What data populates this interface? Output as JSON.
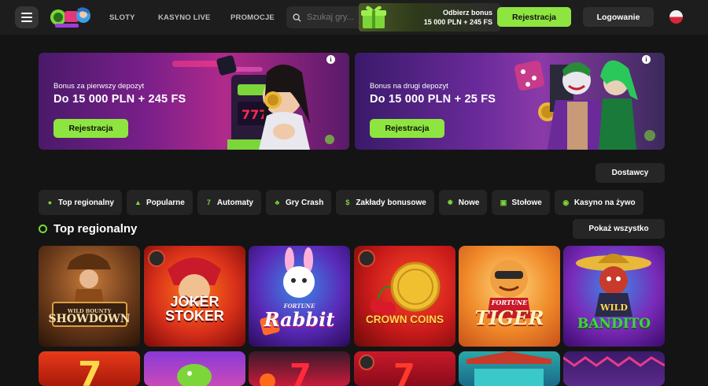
{
  "header": {
    "nav": [
      "SLOTY",
      "KASYNO LIVE",
      "PROMOCJE"
    ],
    "search_placeholder": "Szukaj gry...",
    "bonus_line1": "Odbierz bonus",
    "bonus_line2": "15 000 PLN + 245 FS",
    "register_label": "Rejestracja",
    "login_label": "Logowanie",
    "language": "PL"
  },
  "banners": [
    {
      "subtitle": "Bonus za pierwszy depozyt",
      "headline": "Do 15 000 PLN + 245 FS",
      "cta": "Rejestracja",
      "info": "i"
    },
    {
      "subtitle": "Bonus na drugi depozyt",
      "headline": "Do 15 000 PLN + 25 FS",
      "cta": "Rejestracja",
      "info": "i"
    }
  ],
  "providers_label": "Dostawcy",
  "categories": [
    {
      "label": "Top regionalny",
      "icon": "globe-icon"
    },
    {
      "label": "Popularne",
      "icon": "flame-icon"
    },
    {
      "label": "Automaty",
      "icon": "seven-icon"
    },
    {
      "label": "Gry Crash",
      "icon": "crash-icon"
    },
    {
      "label": "Zakłady bonusowe",
      "icon": "coin-icon"
    },
    {
      "label": "Nowe",
      "icon": "star-icon"
    },
    {
      "label": "Stołowe",
      "icon": "cards-icon"
    },
    {
      "label": "Kasyno na żywo",
      "icon": "live-icon"
    }
  ],
  "section": {
    "title": "Top regionalny",
    "show_all": "Pokaż wszystko"
  },
  "games": [
    {
      "name": "SHOWDOWN",
      "top": "WILD BOUNTY"
    },
    {
      "name": "JOKER STOKER",
      "top": ""
    },
    {
      "name": "Rabbit",
      "top": "FORTUNE"
    },
    {
      "name": "CROWN COINS",
      "top": ""
    },
    {
      "name": "TIGER",
      "top": "FORTUNE"
    },
    {
      "name": "BANDITO",
      "top": "WILD"
    }
  ],
  "colors": {
    "accent": "#8ee53f",
    "background": "#141414",
    "header": "#1d1d1d",
    "chip": "#242424"
  }
}
